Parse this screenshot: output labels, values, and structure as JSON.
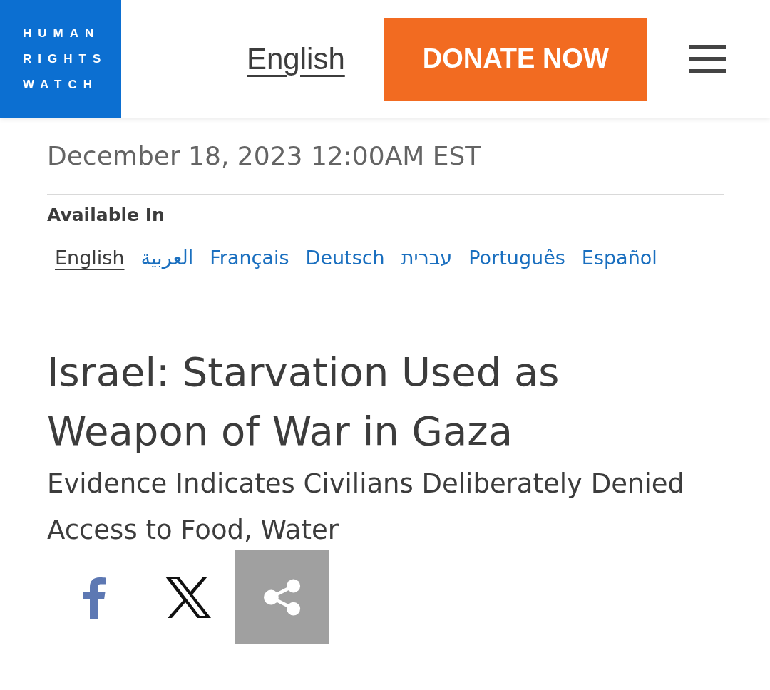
{
  "header": {
    "logo_lines": [
      "HUMAN",
      "RIGHTS",
      "WATCH"
    ],
    "language_link": "English",
    "donate_button": "DONATE NOW"
  },
  "article": {
    "dateline": "December 18, 2023 12:00AM EST",
    "available_in_label": "Available In",
    "languages": [
      {
        "label": "English",
        "selected": true
      },
      {
        "label": "العربية",
        "selected": false
      },
      {
        "label": "Français",
        "selected": false
      },
      {
        "label": "Deutsch",
        "selected": false
      },
      {
        "label": "עברית",
        "selected": false
      },
      {
        "label": "Português",
        "selected": false
      },
      {
        "label": "Español",
        "selected": false
      }
    ],
    "title": "Israel: Starvation Used as Weapon of War in Gaza",
    "subtitle": "Evidence Indicates Civilians Deliberately Denied Access to Food, Water"
  }
}
